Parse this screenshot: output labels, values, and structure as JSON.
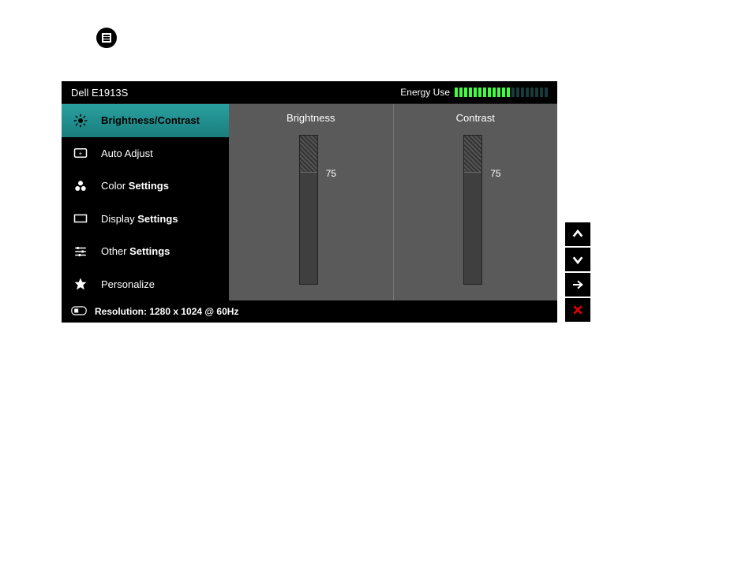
{
  "header": {
    "model": "Dell E1913S",
    "energy_label": "Energy Use",
    "energy_bars_total": 20,
    "energy_bars_on": 12
  },
  "sidebar": {
    "items": [
      {
        "label": "Brightness/Contrast",
        "icon": "brightness-icon",
        "active": true
      },
      {
        "label": "Auto Adjust",
        "icon": "auto-adjust-icon",
        "active": false
      },
      {
        "label": "Color Settings",
        "icon": "color-icon",
        "active": false
      },
      {
        "label": "Display Settings",
        "icon": "display-icon",
        "active": false
      },
      {
        "label": "Other Settings",
        "icon": "sliders-icon",
        "active": false
      },
      {
        "label": "Personalize",
        "icon": "star-icon",
        "active": false
      }
    ]
  },
  "panel": {
    "columns": [
      {
        "title": "Brightness",
        "value": 75,
        "max": 100
      },
      {
        "title": "Contrast",
        "value": 75,
        "max": 100
      }
    ]
  },
  "footer": {
    "resolution_label": "Resolution: 1280 x 1024 @ 60Hz"
  },
  "nav": {
    "buttons": [
      "up",
      "down",
      "right",
      "close"
    ]
  }
}
